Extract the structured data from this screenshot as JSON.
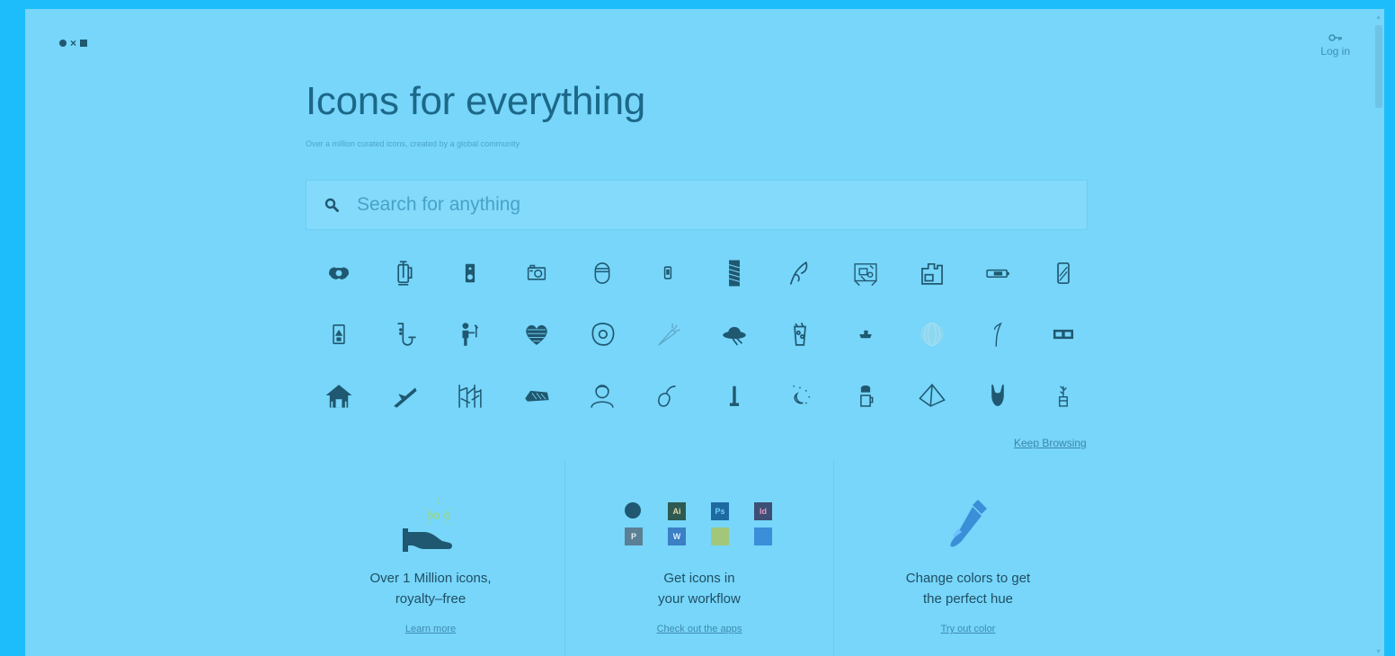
{
  "brand": {
    "logo_symbols": [
      "●",
      "×",
      "■"
    ]
  },
  "header": {
    "login_label": "Log in",
    "login_icon": "key-icon"
  },
  "hero": {
    "title": "Icons for everything",
    "subtitle": "Over a million curated icons, created by a global community"
  },
  "search": {
    "placeholder": "Search for anything",
    "value": "",
    "icon": "search-icon"
  },
  "icon_grid": {
    "rows": [
      [
        "wreath-icon",
        "french-press-icon",
        "speaker-icon",
        "camera-icon",
        "jar-icon",
        "phone-icon",
        "building-icon",
        "leaf-hand-icon",
        "room-icon",
        "factory-icon",
        "battery-icon",
        "smartphone-icon"
      ],
      [
        "card-icon",
        "saxophone-icon",
        "person-drinking-icon",
        "heart-pattern-icon",
        "egg-icon",
        "carrot-icon",
        "hat-icon",
        "cocktail-icon",
        "boat-icon",
        "sphere-icon",
        "feather-icon",
        "cassette-icon"
      ],
      [
        "house-icon",
        "airplane-icon",
        "forest-icon",
        "bed-icon",
        "person-icon",
        "fruit-icon",
        "chess-piece-icon",
        "night-sky-icon",
        "coffee-cup-icon",
        "pyramid-icon",
        "swimsuit-icon",
        "plant-pot-icon"
      ]
    ]
  },
  "keep_browsing_label": "Keep Browsing",
  "features": [
    {
      "title_line1": "Over 1 Million icons,",
      "title_line2": "royalty–free",
      "link": "Learn more",
      "icon": "hand-infinity-icon"
    },
    {
      "title_line1": "Get icons in",
      "title_line2": "your workflow",
      "link": "Check out the apps",
      "apps": [
        {
          "name": "apple-icon",
          "label": "",
          "bg": "#1f5870",
          "fg": "#77d6fa"
        },
        {
          "name": "illustrator-icon",
          "label": "Ai",
          "bg": "#2e5a52",
          "fg": "#e3d7a8"
        },
        {
          "name": "photoshop-icon",
          "label": "Ps",
          "bg": "#1d6aa0",
          "fg": "#6fd1fb"
        },
        {
          "name": "indesign-icon",
          "label": "Id",
          "bg": "#3e4f75",
          "fg": "#e09ac4"
        },
        {
          "name": "powerpoint-icon",
          "label": "P",
          "bg": "#5b7f94",
          "fg": "#e4eef2"
        },
        {
          "name": "word-icon",
          "label": "W",
          "bg": "#3b7fc4",
          "fg": "#dbefff"
        },
        {
          "name": "google-slides-icon",
          "label": "",
          "bg": "#a3c77a",
          "fg": "#ffffff"
        },
        {
          "name": "google-docs-icon",
          "label": "",
          "bg": "#3b8fd8",
          "fg": "#ffffff"
        }
      ]
    },
    {
      "title_line1": "Change colors to get",
      "title_line2": "the perfect hue",
      "link": "Try out color",
      "icon": "eyedropper-icon"
    }
  ]
}
